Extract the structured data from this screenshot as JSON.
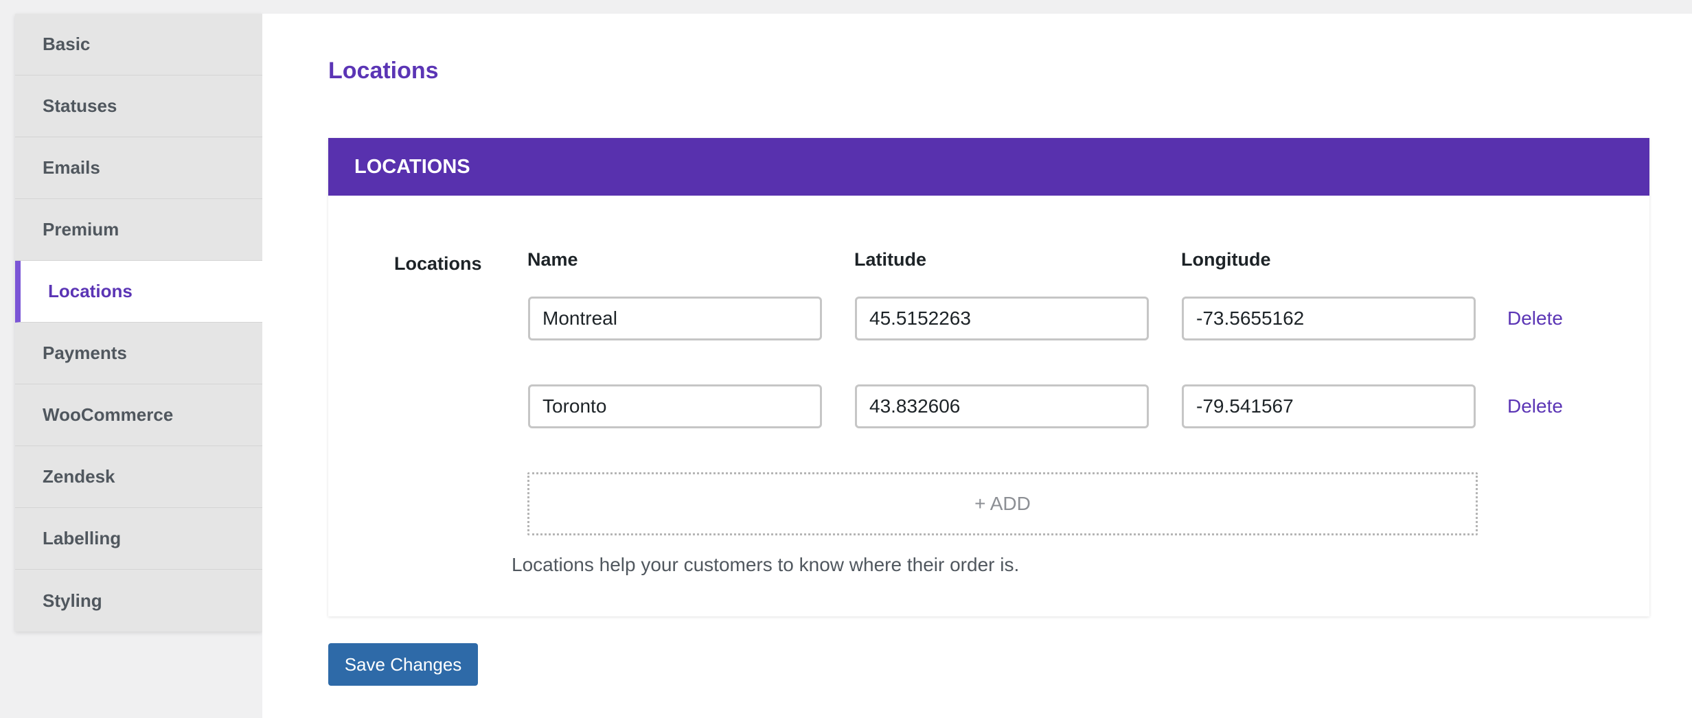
{
  "sidebar": {
    "items": [
      {
        "label": "Basic"
      },
      {
        "label": "Statuses"
      },
      {
        "label": "Emails"
      },
      {
        "label": "Premium"
      },
      {
        "label": "Locations",
        "active": true
      },
      {
        "label": "Payments"
      },
      {
        "label": "WooCommerce"
      },
      {
        "label": "Zendesk"
      },
      {
        "label": "Labelling"
      },
      {
        "label": "Styling"
      }
    ]
  },
  "page": {
    "title": "Locations"
  },
  "panel": {
    "header": "LOCATIONS",
    "field_label": "Locations",
    "columns": {
      "name": "Name",
      "latitude": "Latitude",
      "longitude": "Longitude"
    },
    "rows": [
      {
        "name": "Montreal",
        "latitude": "45.5152263",
        "longitude": "-73.5655162",
        "delete_label": "Delete"
      },
      {
        "name": "Toronto",
        "latitude": "43.832606",
        "longitude": "-79.541567",
        "delete_label": "Delete"
      }
    ],
    "add_label": "+ ADD",
    "help_text": "Locations help your customers to know where their order is."
  },
  "actions": {
    "save_label": "Save Changes"
  },
  "colors": {
    "accent": "#5b35b5",
    "header_bg": "#5831ae",
    "save_button": "#2e6aa8"
  }
}
